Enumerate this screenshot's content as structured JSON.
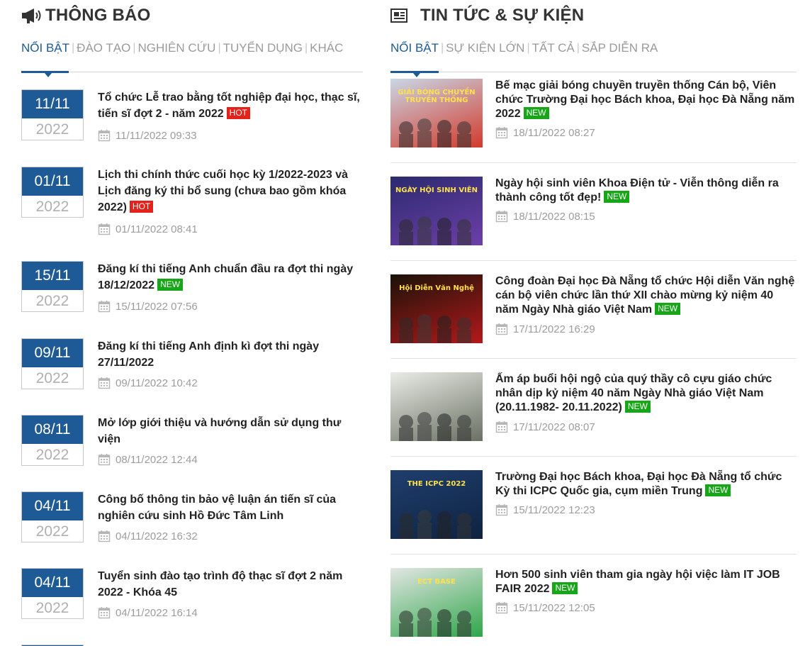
{
  "left": {
    "title": "THÔNG BÁO",
    "icon": "megaphone-icon",
    "tabs": [
      {
        "label": "NỔI BẬT"
      },
      {
        "label": "ĐÀO TẠO"
      },
      {
        "label": "NGHIÊN CỨU"
      },
      {
        "label": "TUYỂN DỤNG"
      },
      {
        "label": "KHÁC"
      }
    ],
    "items": [
      {
        "day": "11/11",
        "year": "2022",
        "title": "Tổ chức Lễ trao bằng tốt nghiệp đại học, thạc sĩ, tiến sĩ đợt 2 - năm 2022",
        "badge": "HOT",
        "datetime": "11/11/2022 09:33"
      },
      {
        "day": "01/11",
        "year": "2022",
        "title": "Lịch thi chính thức cuối học kỳ 1/2022-2023 và Lịch đăng ký thi bổ sung (chưa bao gồm khóa 2022)",
        "badge": "HOT",
        "datetime": "01/11/2022 08:41"
      },
      {
        "day": "15/11",
        "year": "2022",
        "title": "Đăng kí thi tiếng Anh chuẩn đầu ra đợt thi ngày 18/12/2022",
        "badge": "NEW",
        "datetime": "15/11/2022 07:56"
      },
      {
        "day": "09/11",
        "year": "2022",
        "title": "Đăng kí thi tiếng Anh định kì đợt thi ngày 27/11/2022",
        "badge": "",
        "datetime": "09/11/2022 10:42"
      },
      {
        "day": "08/11",
        "year": "2022",
        "title": "Mở lớp giới thiệu và hướng dẫn sử dụng thư viện",
        "badge": "",
        "datetime": "08/11/2022 12:44"
      },
      {
        "day": "04/11",
        "year": "2022",
        "title": "Công bố thông tin bảo vệ luận án tiến sĩ của nghiên cứu sinh Hồ Đức Tâm Linh",
        "badge": "",
        "datetime": "04/11/2022 16:32"
      },
      {
        "day": "04/11",
        "year": "2022",
        "title": "Tuyển sinh đào tạo trình độ thạc sĩ đợt 2 năm 2022 - Khóa 45",
        "badge": "",
        "datetime": "04/11/2022 16:14"
      }
    ]
  },
  "right": {
    "title": "TIN TỨC & SỰ KIỆN",
    "icon": "newspaper-icon",
    "tabs": [
      {
        "label": "NỔI BẬT"
      },
      {
        "label": "SỰ KIỆN LỚN"
      },
      {
        "label": "TẤT CẢ"
      },
      {
        "label": "SẮP DIỄN RA"
      }
    ],
    "items": [
      {
        "title": "Bế mạc giải bóng chuyền truyền thống Cán bộ, Viên chức Trường Đại học Bách khoa, Đại học Đà Nẵng năm 2022",
        "badge": "NEW",
        "datetime": "18/11/2022 08:27",
        "thumb_text": "GIẢI BÓNG CHUYỀN TRUYỀN THỐNG",
        "thumb_colors": [
          "#c9d7e6",
          "#d33a2c"
        ]
      },
      {
        "title": "Ngày hội sinh viên Khoa Điện tử - Viễn thông diễn ra thành công tốt đẹp!",
        "badge": "NEW",
        "datetime": "18/11/2022 08:15",
        "thumb_text": "NGÀY HỘI SINH VIÊN",
        "thumb_colors": [
          "#2b2a6e",
          "#6d3fa8"
        ]
      },
      {
        "title": "Công đoàn Đại học Đà Nẵng tổ chức Hội diễn Văn nghệ cán bộ viên chức lần thứ XII chào mừng kỷ niệm 40 năm Ngày Nhà giáo Việt Nam",
        "badge": "NEW",
        "datetime": "17/11/2022 16:29",
        "thumb_text": "Hội Diễn Văn Nghệ",
        "thumb_colors": [
          "#1a1208",
          "#b3191b"
        ]
      },
      {
        "title": "Ấm áp buổi hội ngộ của quý thầy cô cựu giáo chức nhân dịp kỷ niệm 40 năm Ngày Nhà giáo Việt Nam (20.11.1982- 20.11.2022)",
        "badge": "NEW",
        "datetime": "17/11/2022 08:07",
        "thumb_text": "",
        "thumb_colors": [
          "#e9ece6",
          "#6a7062"
        ]
      },
      {
        "title": "Trường Đại học Bách khoa, Đại học Đà Nẵng tổ chức Kỳ thi ICPC Quốc gia, cụm miền Trung",
        "badge": "NEW",
        "datetime": "15/11/2022 12:23",
        "thumb_text": "THE ICPC 2022",
        "thumb_colors": [
          "#1f3e6e",
          "#0f2340"
        ]
      },
      {
        "title": "Hơn 500 sinh viên tham gia ngày hội việc làm IT JOB FAIR 2022",
        "badge": "NEW",
        "datetime": "15/11/2022 12:05",
        "thumb_text": "ECT BASE",
        "thumb_colors": [
          "#e3e6e3",
          "#2fa64a"
        ]
      }
    ]
  }
}
